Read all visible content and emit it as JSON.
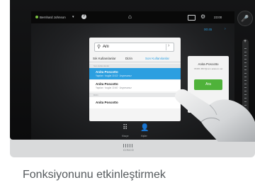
{
  "statusbar": {
    "user_name": "Bernhard Johnson",
    "caret": "▾",
    "help_label": "?",
    "time": "23:00",
    "home_icon": "home-icon",
    "selfview_icon": "selfview-icon",
    "settings_icon": "settings-icon",
    "status_color": "#7cc242"
  },
  "subheader": {
    "time": "00:45",
    "chevron": "›"
  },
  "search": {
    "value": "Ani",
    "go_glyph": "›"
  },
  "tabs": [
    "Sık Kullanılanlar",
    "Dizin",
    "Son Kullanılanlar"
  ],
  "groups": {
    "first": "Son kullanılanlar",
    "second": "Dizin"
  },
  "results": [
    {
      "name": "Anita Poscotto",
      "sub": "Yapılan · bugün 10:13 · Arıyorsunuz"
    },
    {
      "name": "Anita Poscotto",
      "sub": "Yapılan · bugün 10:40 · Arıyorsunuz"
    },
    {
      "name": "Anita Poscotto",
      "sub": ""
    }
  ],
  "bottom_bar": {
    "keypad_label": "Klavye",
    "directory_label": "Kişiler"
  },
  "card": {
    "name": "Anita Poscotto",
    "address": "78465 4567@orm.telekom.net",
    "call_label": "Ara"
  },
  "logo": {
    "word": "CISCO"
  },
  "caption": "Fonksiyonunu etkinleştirmek",
  "colors": {
    "accent": "#2c9fe0",
    "call_green": "#4fb23a"
  }
}
